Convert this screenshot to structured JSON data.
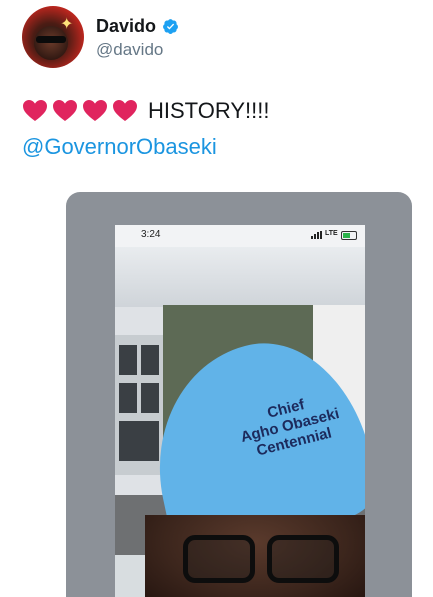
{
  "tweet": {
    "author": {
      "name": "Davido",
      "handle": "@davido",
      "verified": true,
      "avatar_icon": "profile-photo"
    },
    "text": "HISTORY!!!!",
    "emoji": [
      "❤️",
      "❤️",
      "❤️",
      "❤️"
    ],
    "mention": "@GovernorObaseki",
    "colors": {
      "accent": "#1b95e0",
      "text": "#14171a",
      "muted": "#657786",
      "heart": "#e0245e"
    }
  },
  "media": {
    "phone_time": "3:24",
    "network": "LTE",
    "cap_text": [
      "Chief",
      "Agho Obaseki",
      "Centennial"
    ]
  }
}
